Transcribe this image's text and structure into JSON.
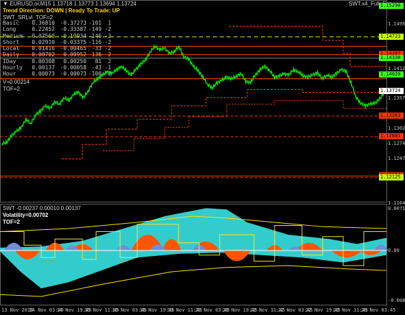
{
  "title": "EURUSD,oi,M15  1.13718 1.13773 1.13694 1.13724",
  "ea_name": "SWT.x4_Full_Exp",
  "trend": {
    "label": "Trend Direction:",
    "value": "DOWN",
    "sep": "|",
    "ready_label": "Ready To Trade:",
    "ready_value": "UP"
  },
  "indicator_name": "SWT_SRLvl_TOF=2",
  "rows": [
    {
      "name": "Basic",
      "a": "0.36810",
      "b": "-0.37273",
      "c": "-101",
      "d": "1"
    },
    {
      "name": "Long",
      "a": "0.22452",
      "b": "-0.33387",
      "c": "-149",
      "d": "-2"
    },
    {
      "name": "Medium",
      "a": "0.07560",
      "b": "-0.10934",
      "c": "-146",
      "d": "-2"
    },
    {
      "name": "Short",
      "a": "0.02910",
      "b": "-0.03375",
      "c": "-116",
      "d": "-2"
    },
    {
      "name": "Local",
      "a": "0.01416",
      "b": "-0.00465",
      "c": "-33",
      "d": "-2"
    },
    {
      "name": "Daily",
      "a": "0.00702",
      "b": "0.00952",
      "c": "136",
      "d": "2"
    },
    {
      "name": "IDay",
      "a": "0.00308",
      "b": "0.00250",
      "c": "81",
      "d": "2"
    },
    {
      "name": "Hourly",
      "a": "0.00137",
      "b": "-0.00058",
      "c": "-43",
      "d": "-1"
    },
    {
      "name": "Hour",
      "a": "0.00073",
      "b": "-0.00073",
      "c": "-100",
      "d": "-2"
    }
  ],
  "v_line": "V=0.00214",
  "tof_line": "TOF=2",
  "price_labels": [
    {
      "text": "1.15290",
      "price": 1.1529,
      "bg": "#39ff14",
      "fg": "#000000"
    },
    {
      "text": "1.14950",
      "price": 1.1495,
      "bg": null
    },
    {
      "text": "1.14723",
      "price": 1.14723,
      "bg": "#c8ff00",
      "fg": "#000000"
    },
    {
      "text": "1.14397",
      "price": 1.14397,
      "bg": "#ff3300",
      "fg": "#000000"
    },
    {
      "text": "1.14330",
      "price": 1.1433,
      "bg": "#39ff14",
      "fg": "#000000"
    },
    {
      "text": "1.14125",
      "price": 1.14125,
      "bg": null
    },
    {
      "text": "1.14020",
      "price": 1.1402,
      "bg": "#39ff14",
      "fg": "#000000"
    },
    {
      "text": "1.13724",
      "price": 1.13724,
      "bg": "#ffffff",
      "fg": "#000000"
    },
    {
      "text": "1.13575",
      "price": 1.13575,
      "bg": null
    },
    {
      "text": "1.13263",
      "price": 1.13263,
      "bg": "#ff3300",
      "fg": "#000000"
    },
    {
      "text": "1.13020",
      "price": 1.1302,
      "bg": null
    },
    {
      "text": "1.12881",
      "price": 1.12881,
      "bg": "#ff3300",
      "fg": "#000000"
    },
    {
      "text": "1.12745",
      "price": 1.12745,
      "bg": null
    },
    {
      "text": "1.12470",
      "price": 1.1247,
      "bg": null
    },
    {
      "text": "1.12154",
      "price": 1.12154,
      "bg": "#ff3300",
      "fg": "#000000"
    },
    {
      "text": "1.12125",
      "price": 1.12125,
      "bg": "#c8ff00",
      "fg": "#000000"
    },
    {
      "text": "1.11640",
      "price": 1.1164,
      "bg": null
    }
  ],
  "sub_title": "SWT -0.00237 0.00010 0.00137",
  "volatility": "Volatility=0.00702",
  "sub_tof": "TOF=2",
  "sub_axis": [
    "0.00717",
    "0.00",
    "-0.00884"
  ],
  "x_labels": [
    "13 Nov 2018",
    "14 Nov 03:45",
    "14 Nov 19:45",
    "15 Nov 11:45",
    "16 Nov 03:45",
    "16 Nov 19:45",
    "19 Nov 11:45",
    "20 Nov 03:45",
    "20 Nov 19:45",
    "21 Nov 11:45",
    "22 Nov 03:45",
    "22 Nov 19:45",
    "23 Nov 11:45",
    "26 Nov 03:45"
  ],
  "colors": {
    "price": "#00e000",
    "resistance": "#ff3300",
    "sub_cyan": "#33cccc",
    "sub_orange": "#ff5500",
    "sub_blue": "#6f8fd6",
    "sub_yellow": "#ffe100"
  },
  "chart_data": {
    "type": "line",
    "series": [
      {
        "name": "EURUSD,oi,M15",
        "y": [
          1.1275,
          1.1278,
          1.129,
          1.1298,
          1.1305,
          1.132,
          1.1312,
          1.1328,
          1.1335,
          1.1345,
          1.134,
          1.1352,
          1.1348,
          1.136,
          1.1355,
          1.1366,
          1.137,
          1.136,
          1.1372,
          1.1388,
          1.1395,
          1.1402,
          1.1408,
          1.1405,
          1.1412,
          1.1418,
          1.141,
          1.1402,
          1.1412,
          1.1422,
          1.143,
          1.1445,
          1.1455,
          1.1448,
          1.1452,
          1.1442,
          1.1445,
          1.1455,
          1.1435,
          1.1432,
          1.1418,
          1.141,
          1.1398,
          1.1385,
          1.1378,
          1.1388,
          1.1392,
          1.1398,
          1.1395,
          1.14,
          1.1405,
          1.139,
          1.1388,
          1.1402,
          1.1412,
          1.1418,
          1.141,
          1.1398,
          1.14,
          1.1404,
          1.1402,
          1.1412,
          1.1408,
          1.14,
          1.1398,
          1.1402,
          1.1406,
          1.1395,
          1.1402,
          1.1398,
          1.1405,
          1.1412,
          1.1408,
          1.1388,
          1.1362,
          1.135,
          1.1345,
          1.1348,
          1.135,
          1.1358,
          1.137
        ]
      }
    ]
  }
}
